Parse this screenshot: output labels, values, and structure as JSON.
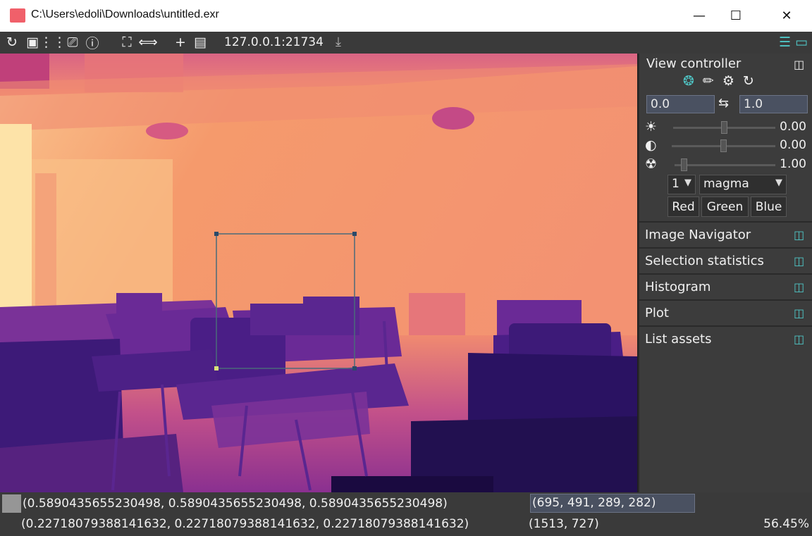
{
  "window": {
    "title": "C:\\Users\\edoli\\Downloads\\untitled.exr",
    "minimize_icon": "minimize-icon",
    "maximize_icon": "maximize-icon",
    "close_icon": "close-icon"
  },
  "toolbar": {
    "icons": [
      "refresh-icon",
      "calendar-icon",
      "grid-icon",
      "clipboard-icon",
      "info-icon",
      "fullscreen-icon",
      "exit-fullscreen-icon",
      "add-icon",
      "gallery-icon"
    ],
    "server": "127.0.0.1:21734",
    "download_icon": "download-icon",
    "right_icons": [
      "sliders-icon",
      "monitor-icon"
    ]
  },
  "viewer": {
    "colormap_colors": [
      "#2a0f4e",
      "#5b1f8e",
      "#a43f86",
      "#e0607a",
      "#f59a6c",
      "#fcd8a0"
    ],
    "selection_visible": true
  },
  "panel": {
    "view_controller": {
      "title": "View controller",
      "mode_icons": [
        "aperture-icon",
        "brush-icon",
        "toggle-icon",
        "sync-icon"
      ],
      "min_value": "0.0",
      "max_value": "1.0",
      "swap_icon": "swap-icon",
      "sliders": [
        {
          "icon": "brightness-icon",
          "value": "0.00",
          "level": 0.5
        },
        {
          "icon": "contrast-icon",
          "value": "0.00",
          "level": 0.5
        },
        {
          "icon": "gamma-icon",
          "value": "1.00",
          "level": 0.08
        }
      ],
      "channel_select": "1",
      "colormap_select": "magma",
      "channel_buttons": [
        "Red",
        "Green",
        "Blue"
      ]
    },
    "sections": [
      "Image Navigator",
      "Selection statistics",
      "Histogram",
      "Plot",
      "List assets"
    ]
  },
  "status": {
    "pixel_value_1": "(0.5890435655230498, 0.5890435655230498, 0.5890435655230498)",
    "pixel_value_2": "(0.22718079388141632, 0.22718079388141632, 0.22718079388141632)",
    "roi": "(695, 491, 289, 282)",
    "cursor": "(1513, 727)",
    "zoom": "56.45%"
  }
}
